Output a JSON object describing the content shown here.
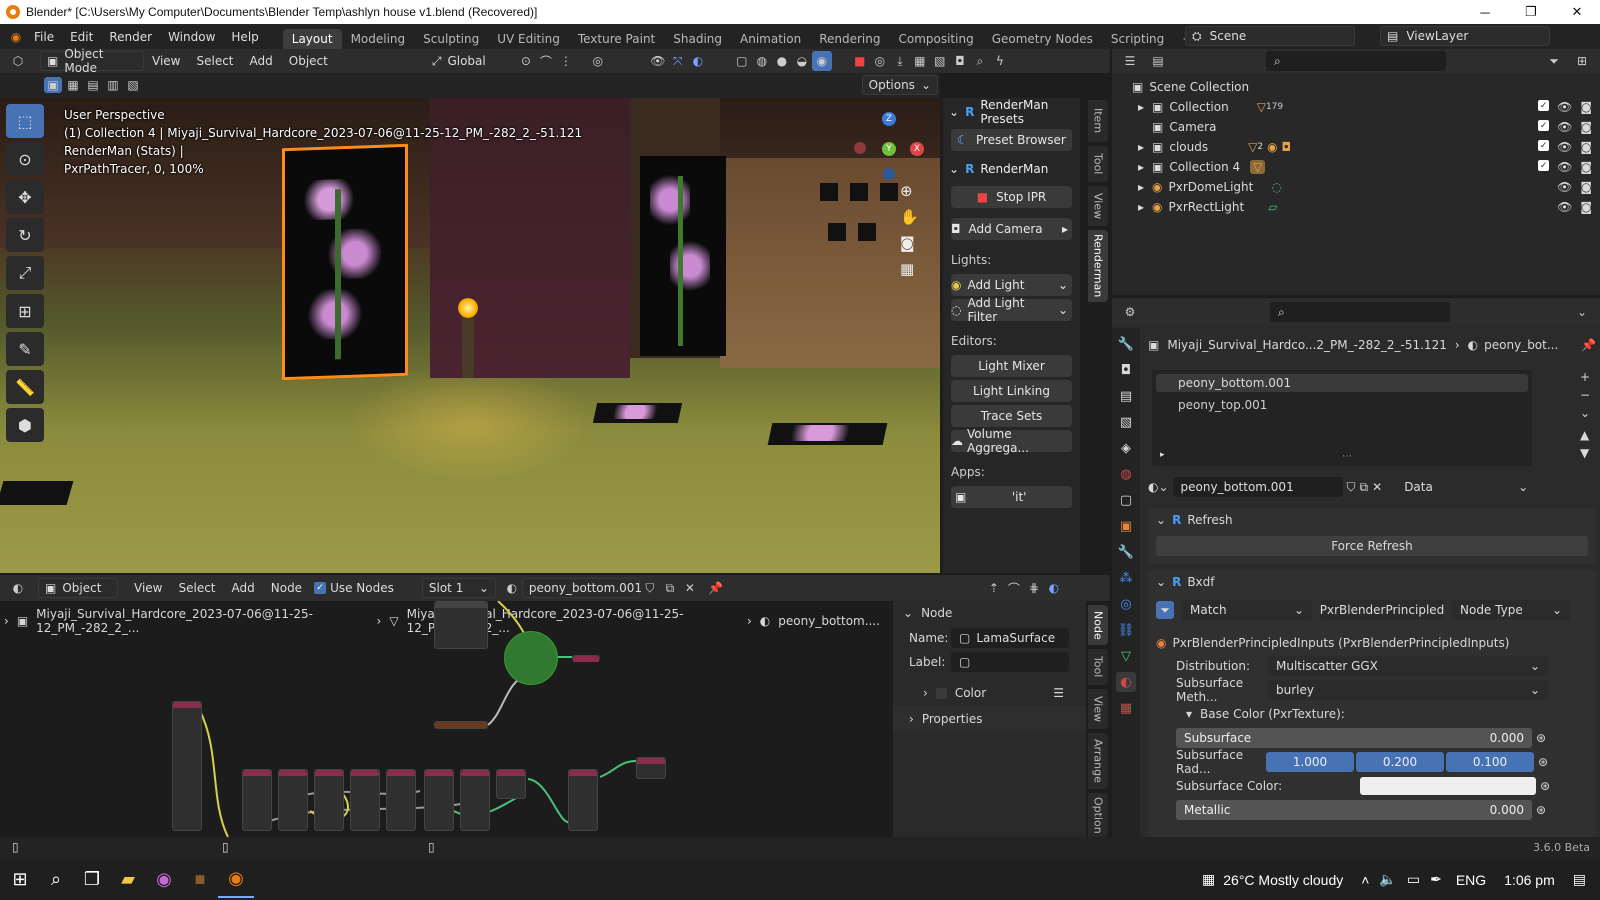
{
  "window": {
    "title": "Blender* [C:\\Users\\My Computer\\Documents\\Blender Temp\\ashlyn house v1.blend (Recovered)]"
  },
  "menu": {
    "items": [
      "File",
      "Edit",
      "Render",
      "Window",
      "Help"
    ],
    "workspaces": [
      "Layout",
      "Modeling",
      "Sculpting",
      "UV Editing",
      "Texture Paint",
      "Shading",
      "Animation",
      "Rendering",
      "Compositing",
      "Geometry Nodes",
      "Scripting"
    ],
    "active_workspace": "Layout",
    "scene": "Scene",
    "view_layer": "ViewLayer"
  },
  "viewport_header": {
    "mode": "Object Mode",
    "menus": [
      "View",
      "Select",
      "Add",
      "Object"
    ],
    "orientation": "Global",
    "options": "Options"
  },
  "viewport_overlay": {
    "line1": "User Perspective",
    "line2": "(1) Collection 4 | Miyaji_Survival_Hardcore_2023-07-06@11-25-12_PM_-282_2_-51.121",
    "line3": "RenderMan (Stats) |",
    "line4": "PxrPathTracer, 0, 100%"
  },
  "renderman_panel": {
    "presets_title": "RenderMan Presets",
    "preset_browser": "Preset Browser",
    "renderman_title": "RenderMan",
    "stop_ipr": "Stop IPR",
    "add_camera": "Add Camera",
    "lights_label": "Lights:",
    "add_light": "Add Light",
    "add_light_filter": "Add Light Filter",
    "editors_label": "Editors:",
    "light_mixer": "Light Mixer",
    "light_linking": "Light Linking",
    "trace_sets": "Trace Sets",
    "volume_aggregates": "Volume Aggrega...",
    "apps_label": "Apps:",
    "it_app": "'it'",
    "side_tabs": [
      "Item",
      "Tool",
      "View",
      "Renderman"
    ]
  },
  "outliner": {
    "root": "Scene Collection",
    "items": [
      {
        "name": "Collection",
        "badge": "179"
      },
      {
        "name": "Camera",
        "badge": ""
      },
      {
        "name": "clouds",
        "badge": "2"
      },
      {
        "name": "Collection 4",
        "badge": ""
      },
      {
        "name": "PxrDomeLight",
        "badge": ""
      },
      {
        "name": "PxrRectLight",
        "badge": ""
      }
    ]
  },
  "properties": {
    "breadcrumb_object": "Miyaji_Survival_Hardco...2_PM_-282_2_-51.121",
    "breadcrumb_material": "peony_bot...",
    "slots": [
      "peony_bottom.001",
      "peony_top.001"
    ],
    "material_name": "peony_bottom.001",
    "link_mode": "Data",
    "refresh_title": "Refresh",
    "force_refresh": "Force Refresh",
    "bxdf_title": "Bxdf",
    "match": "Match",
    "bxdf_type": "PxrBlenderPrincipled",
    "node_type": "Node Type",
    "inputs_title": "PxrBlenderPrincipledInputs (PxrBlenderPrincipledInputs)",
    "distribution_label": "Distribution:",
    "distribution_value": "Multiscatter GGX",
    "subsurface_method_label": "Subsurface Meth...",
    "subsurface_method_value": "burley",
    "base_color_label": "Base Color (PxrTexture):",
    "subsurface_label": "Subsurface",
    "subsurface_value": "0.000",
    "subsurface_radius_label": "Subsurface Rad...",
    "subsurface_radius": [
      "1.000",
      "0.200",
      "0.100"
    ],
    "subsurface_color_label": "Subsurface Color:",
    "metallic_label": "Metallic",
    "metallic_value": "0.000"
  },
  "node_editor": {
    "type": "Object",
    "menus": [
      "View",
      "Select",
      "Add",
      "Node"
    ],
    "use_nodes": "Use Nodes",
    "slot": "Slot 1",
    "material": "peony_bottom.001",
    "breadcrumb_1": "Miyaji_Survival_Hardcore_2023-07-06@11-25-12_PM_-282_2_...",
    "breadcrumb_2": "Miyaji_Survival_Hardcore_2023-07-06@11-25-12_PM_-282_2_...",
    "breadcrumb_3": "peony_bottom....",
    "side_tabs": [
      "Node",
      "Tool",
      "View",
      "Arrange",
      "Option"
    ]
  },
  "node_sidebar": {
    "title": "Node",
    "name_label": "Name:",
    "name_value": "LamaSurface",
    "label_label": "Label:",
    "color_label": "Color",
    "properties_label": "Properties"
  },
  "status": {
    "version": "3.6.0 Beta"
  },
  "taskbar": {
    "weather": "26°C  Mostly cloudy",
    "lang": "ENG",
    "time": "1:06 pm"
  },
  "colors": {
    "accent": "#4772b3",
    "selection_outline": "#ff8c1a",
    "node_header": "#8b2d4a"
  }
}
